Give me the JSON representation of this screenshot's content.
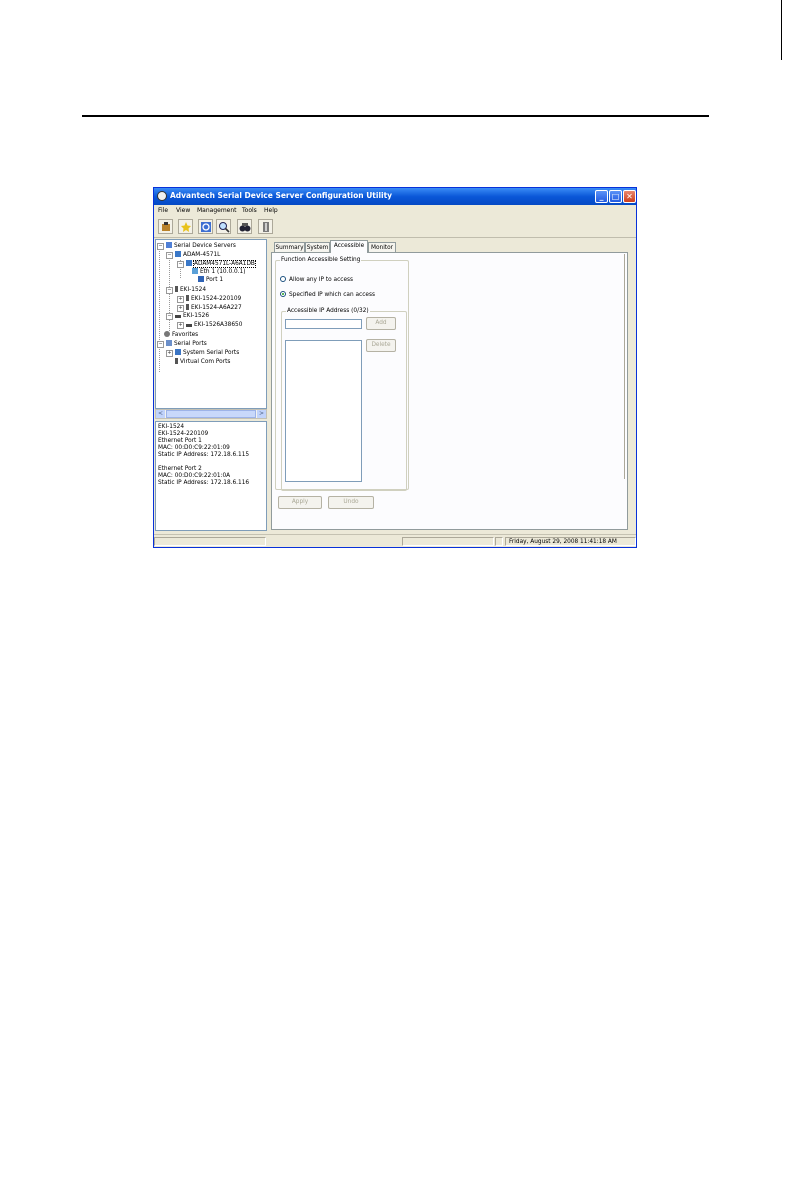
{
  "window": {
    "title": "Advantech Serial Device Server Configuration Utility",
    "minimize_glyph": "_",
    "maximize_glyph": "□",
    "close_glyph": "✕"
  },
  "menu": [
    "File",
    "View",
    "Management",
    "Tools",
    "Help"
  ],
  "toolbar": {
    "icons": [
      "add-server-icon",
      "search-server-icon",
      "refresh-icon",
      "magnifier-icon",
      "binoculars-icon",
      "exit-icon"
    ]
  },
  "tree": {
    "root": "Serial Device Servers",
    "adam": "ADAM-4571L",
    "adam_device": "ADAM4571L-A6A1DB",
    "eth1": "Eth 1 (10.0.0.1)",
    "port1": "Port 1",
    "eki1524": "EKI-1524",
    "eki1524_a": "EKI-1524-220109",
    "eki1524_b": "EKI-1524-A6A227",
    "eki1526": "EKI-1526",
    "eki1526_a": "EKI-1526A38650",
    "favorites": "Favorites",
    "serial_ports": "Serial Ports",
    "system_serial_ports": "System Serial Ports",
    "virtual_com_ports": "Virtual Com Ports",
    "expand_glyph": "+",
    "collapse_glyph": "−"
  },
  "scrollbar": {
    "left_arrow": "<",
    "right_arrow": ">"
  },
  "info": {
    "lines": [
      "EKI-1524",
      "EKI-1524-220109",
      "Ethernet Port 1",
      "MAC: 00:D0:C9:22:01:09",
      "Static IP Address: 172.18.6.115",
      "",
      "Ethernet Port 2",
      "MAC: 00:D0:C9:22:01:0A",
      "Static IP Address: 172.18.6.116"
    ]
  },
  "tabs": [
    "Summary",
    "System",
    "Accessible",
    "Monitor"
  ],
  "accessible": {
    "group_title": "Function Accessible Setting",
    "option_any": "Allow any IP to access",
    "option_specified": "Specified IP which can access",
    "ip_group_title": "Accessible IP Address (0/32)",
    "ip_input_value": "",
    "add_label": "Add",
    "delete_label": "Delete",
    "apply_label": "Apply",
    "undo_label": "Undo"
  },
  "status": {
    "datetime": "Friday, August 29, 2008  11:41:18 AM"
  }
}
